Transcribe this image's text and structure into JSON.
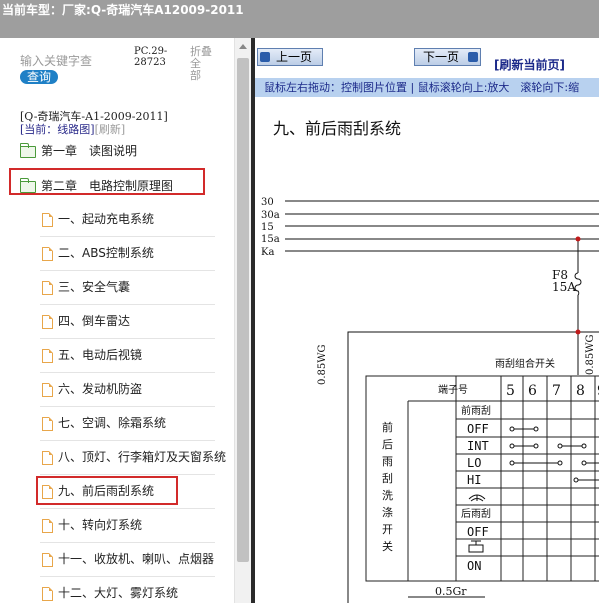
{
  "header": {
    "label": "当前车型：",
    "value": "厂家:Q-奇瑞汽车A12009-2011"
  },
  "sidebar": {
    "search_placeholder": "输入关键字查",
    "search_button": "查询",
    "pc_line1": "PC.29-",
    "pc_line2": "28723",
    "fold_line1": "折叠全",
    "fold_line2": "部",
    "crumb_title": "[Q-奇瑞汽车-A1-2009-2011]",
    "crumb_current": "[当前：线路图]",
    "crumb_refresh": "[刷新]",
    "items": [
      {
        "label": "第一章　读图说明",
        "icon": "folder-icon"
      },
      {
        "label": "第二章　电路控制原理图",
        "icon": "folder-open-icon"
      },
      {
        "label": "一、起动充电系统",
        "icon": "page-icon"
      },
      {
        "label": "二、ABS控制系统",
        "icon": "page-icon"
      },
      {
        "label": "三、安全气囊",
        "icon": "page-icon"
      },
      {
        "label": "四、倒车雷达",
        "icon": "page-icon"
      },
      {
        "label": "五、电动后视镜",
        "icon": "page-icon"
      },
      {
        "label": "六、发动机防盗",
        "icon": "page-icon"
      },
      {
        "label": "七、空调、除霜系统",
        "icon": "page-icon"
      },
      {
        "label": "八、顶灯、行李箱灯及天窗系统",
        "icon": "page-icon"
      },
      {
        "label": "九、前后雨刮系统",
        "icon": "page-icon"
      },
      {
        "label": "十、转向灯系统",
        "icon": "page-icon"
      },
      {
        "label": "十一、收放机、喇叭、点烟器",
        "icon": "page-icon"
      },
      {
        "label": "十二、大灯、雾灯系统",
        "icon": "page-icon"
      }
    ]
  },
  "toolbar": {
    "prev_label": "上一页",
    "next_label": "下一页",
    "refresh_label": "[刷新当前页]",
    "hint": "鼠标左右拖动：控制图片位置 | 鼠标滚轮向上:放大　滚轮向下:缩"
  },
  "diagram": {
    "title": "九、前后雨刮系统",
    "bus_labels": [
      "30",
      "30a",
      "15",
      "15a",
      "Ka"
    ],
    "fuse_label": "F8",
    "fuse_rating": "15A",
    "wire_left": "0.85WG",
    "wire_right": "0.85WG",
    "switch_title": "雨刮组合开关",
    "terminal_header": "端子号",
    "terminals": [
      "5",
      "6",
      "7",
      "8",
      "9"
    ],
    "side_label": [
      "前",
      "后",
      "雨",
      "刮",
      "洗",
      "涤",
      "开",
      "关"
    ],
    "front_group": "前雨刮",
    "rear_group": "后雨刮",
    "front_modes": [
      "OFF",
      "INT",
      "LO",
      "HI"
    ],
    "rear_modes": [
      "OFF",
      "ON"
    ],
    "bottom_wire": "0.5Gr"
  }
}
